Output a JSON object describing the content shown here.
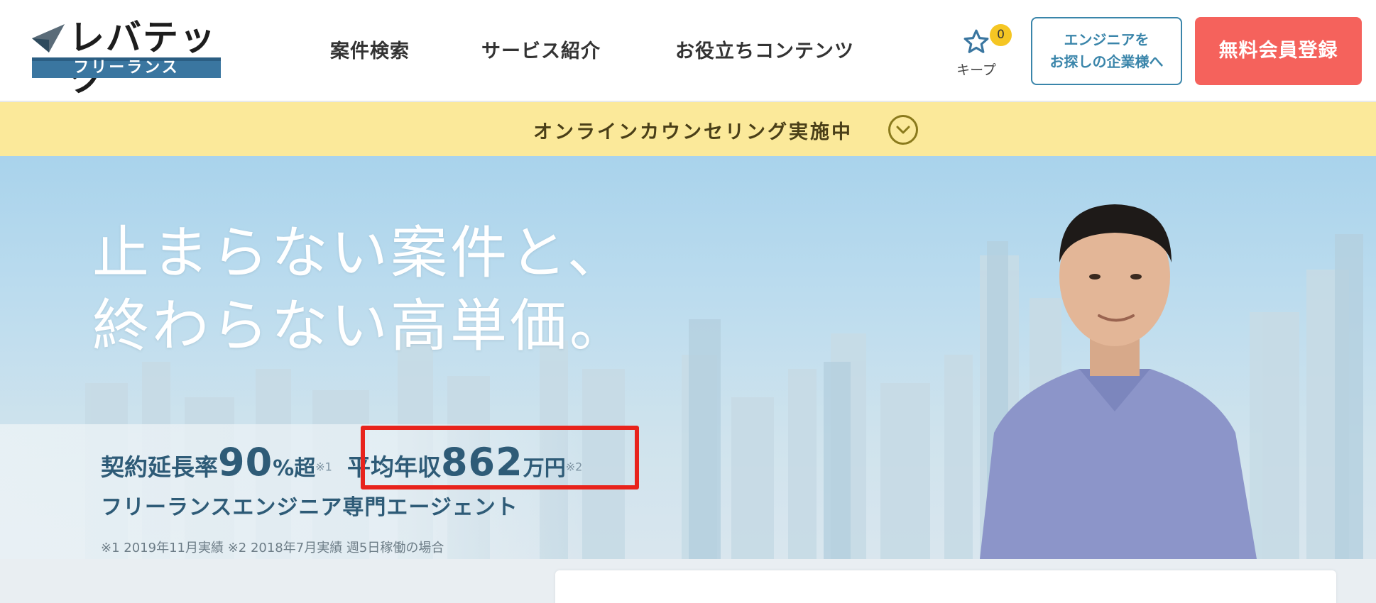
{
  "header": {
    "logo": {
      "brand": "レバテック",
      "sub": "フリーランス"
    },
    "nav": [
      "案件検索",
      "サービス紹介",
      "お役立ちコンテンツ"
    ],
    "keep": {
      "count": "0",
      "label": "キープ"
    },
    "corp_button": {
      "line1": "エンジニアを",
      "line2": "お探しの企業様へ"
    },
    "register_button": "無料会員登録"
  },
  "banner": {
    "text": "オンラインカウンセリング実施中"
  },
  "hero": {
    "headline_1": "止まらない案件と、",
    "headline_2": "終わらない高単価。",
    "stat1": {
      "label": "契約延長率",
      "value": "90",
      "unit": "%超",
      "note": "※1"
    },
    "stat2": {
      "label": "平均年収",
      "value": "862",
      "unit": "万円",
      "note": "※2"
    },
    "tagline": "フリーランスエンジニア専門エージェント",
    "footnote": "※1 2019年11月実績 ※2 2018年7月実績 週5日稼働の場合"
  },
  "colors": {
    "accent": "#f5625c",
    "brand_blue": "#3a76a0",
    "banner": "#fbe99a",
    "highlight": "#e8231c"
  },
  "icons": [
    "logo-mark-icon",
    "star-icon",
    "chevron-down-icon"
  ]
}
